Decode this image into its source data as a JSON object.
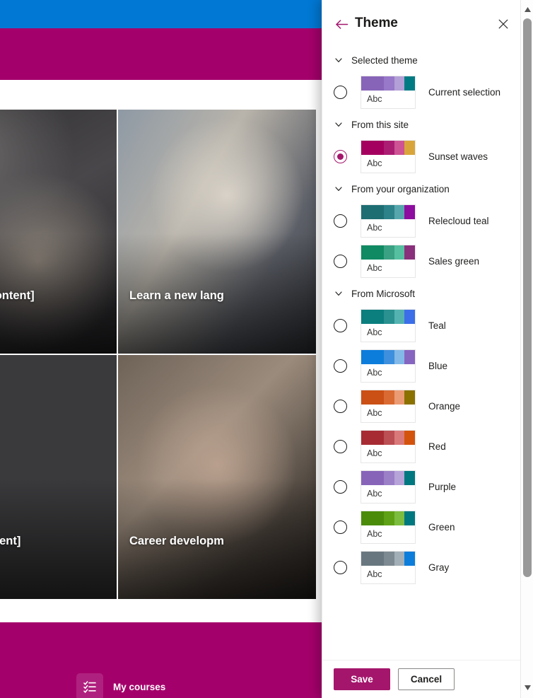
{
  "background": {
    "topbar_color": "#0078d4",
    "sitebar_color": "#a4006b",
    "cards": [
      {
        "title": "s [Sample content]",
        "image": "handshake-photo"
      },
      {
        "title": "Learn a new lang",
        "image": "meeting-photo"
      },
      {
        "title": "Sample content]",
        "image": "desk-photo"
      },
      {
        "title": "Career developm",
        "image": "hands-photo"
      }
    ],
    "footer_nav": {
      "label": "My courses",
      "icon": "checklist-icon"
    }
  },
  "panel": {
    "title": "Theme",
    "back_icon": "back-arrow-icon",
    "close_icon": "close-icon",
    "accent_color": "#a4166c",
    "sections": [
      {
        "label": "Selected theme",
        "themes": [
          {
            "name": "Current selection",
            "selected": false,
            "sample_text": "Abc",
            "colors": [
              "#8764b8",
              "#9878c8",
              "#b3a0d6",
              "#007b84"
            ]
          }
        ]
      },
      {
        "label": "From this site",
        "themes": [
          {
            "name": "Sunset waves",
            "selected": true,
            "sample_text": "Abc",
            "colors": [
              "#a4005f",
              "#ab1d73",
              "#cd5394",
              "#d9a53b"
            ]
          }
        ]
      },
      {
        "label": "From your organization",
        "themes": [
          {
            "name": "Relecloud teal",
            "selected": false,
            "sample_text": "Abc",
            "colors": [
              "#1d6e72",
              "#2d8189",
              "#56a7ad",
              "#8f0ca0"
            ]
          },
          {
            "name": "Sales green",
            "selected": false,
            "sample_text": "Abc",
            "colors": [
              "#0f8a63",
              "#3aa183",
              "#56bfa0",
              "#8a2f7b"
            ]
          }
        ]
      },
      {
        "label": "From Microsoft",
        "themes": [
          {
            "name": "Teal",
            "selected": false,
            "sample_text": "Abc",
            "colors": [
              "#0b7e7e",
              "#2a9090",
              "#54b3b0",
              "#3b6ee8"
            ]
          },
          {
            "name": "Blue",
            "selected": false,
            "sample_text": "Abc",
            "colors": [
              "#0c7ddb",
              "#3e8fdd",
              "#83b9e8",
              "#8665c0"
            ]
          },
          {
            "name": "Orange",
            "selected": false,
            "sample_text": "Abc",
            "colors": [
              "#ca5015",
              "#da6a33",
              "#eb9b73",
              "#8a7100"
            ]
          },
          {
            "name": "Red",
            "selected": false,
            "sample_text": "Abc",
            "colors": [
              "#a72b33",
              "#bb4f53",
              "#d9797a",
              "#d3530d"
            ]
          },
          {
            "name": "Purple",
            "selected": false,
            "sample_text": "Abc",
            "colors": [
              "#8764b8",
              "#9b7fc7",
              "#b6a3d8",
              "#00787f"
            ]
          },
          {
            "name": "Green",
            "selected": false,
            "sample_text": "Abc",
            "colors": [
              "#4a8c09",
              "#5fa116",
              "#7cbc3f",
              "#00787f"
            ]
          },
          {
            "name": "Gray",
            "selected": false,
            "sample_text": "Abc",
            "colors": [
              "#68777f",
              "#7d8a91",
              "#a3afb6",
              "#0c7ddb"
            ]
          }
        ]
      }
    ],
    "footer": {
      "save_label": "Save",
      "cancel_label": "Cancel"
    }
  },
  "scrollbar": {
    "up_icon": "scroll-up-icon",
    "down_icon": "scroll-down-icon",
    "thumb": "scroll-thumb"
  }
}
